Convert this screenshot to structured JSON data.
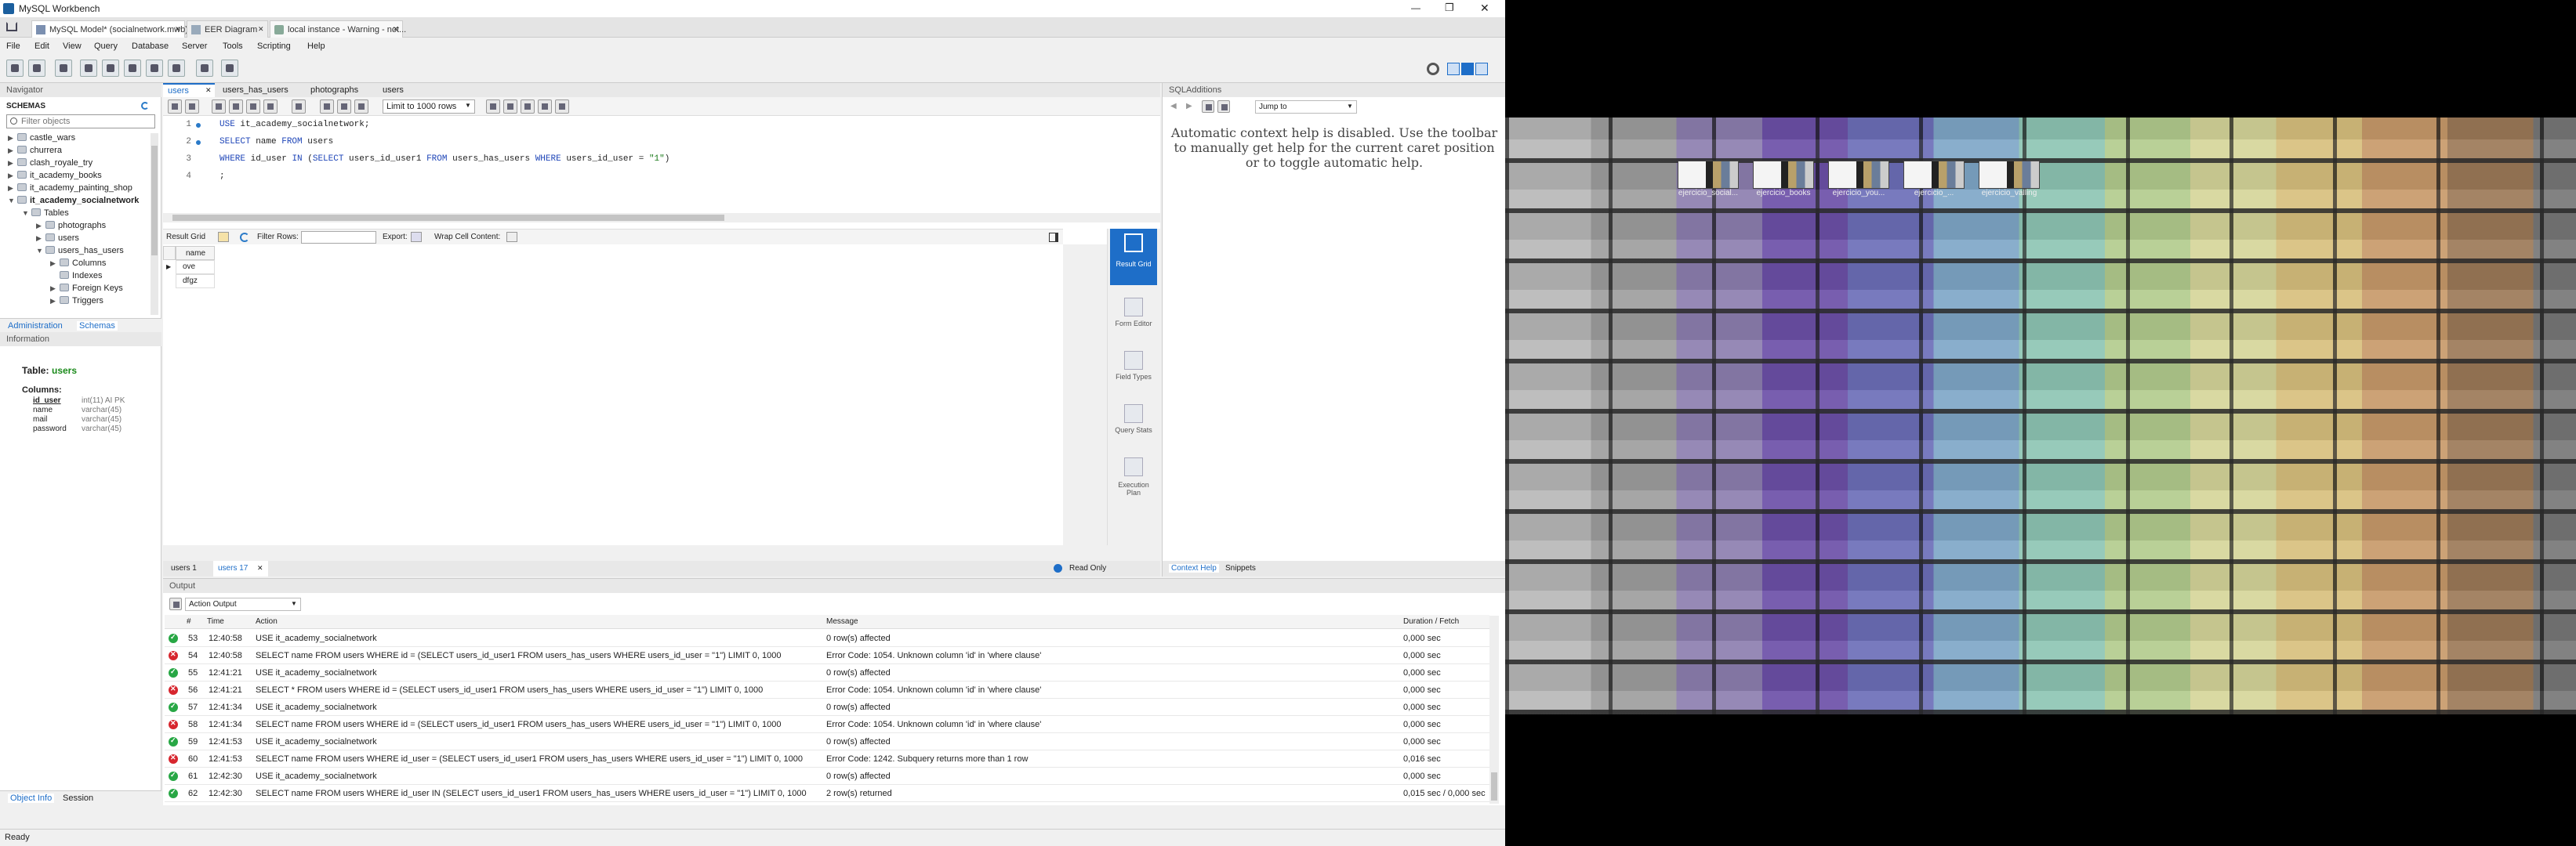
{
  "window": {
    "title": "MySQL Workbench",
    "min": "—",
    "max": "❐",
    "close": "✕"
  },
  "tabs": [
    {
      "label": "MySQL Model* (socialnetwork.mwb)",
      "close": "✕"
    },
    {
      "label": "EER Diagram",
      "close": "✕"
    },
    {
      "label": "local instance - Warning - not...",
      "close": "✕"
    }
  ],
  "menu": [
    "File",
    "Edit",
    "View",
    "Query",
    "Database",
    "Server",
    "Tools",
    "Scripting",
    "Help"
  ],
  "navigator": {
    "title": "Navigator",
    "schemas_label": "SCHEMAS",
    "filter_placeholder": "Filter objects",
    "schemas": [
      "castle_wars",
      "churrera",
      "clash_royale_try",
      "it_academy_books",
      "it_academy_painting_shop",
      "it_academy_socialnetwork"
    ],
    "tables_label": "Tables",
    "tables": [
      "photographs",
      "users",
      "users_has_users"
    ],
    "subitems": [
      "Columns",
      "Indexes",
      "Foreign Keys",
      "Triggers"
    ],
    "tabs": [
      "Administration",
      "Schemas"
    ]
  },
  "information": {
    "title": "Information",
    "table_label": "Table:",
    "table_name": "users",
    "columns_label": "Columns:",
    "columns": [
      {
        "name": "id_user",
        "type": "int(11) AI PK"
      },
      {
        "name": "name",
        "type": "varchar(45)"
      },
      {
        "name": "mail",
        "type": "varchar(45)"
      },
      {
        "name": "password",
        "type": "varchar(45)"
      }
    ],
    "tabs": [
      "Object Info",
      "Session"
    ]
  },
  "editor": {
    "tabs": [
      "users",
      "users_has_users",
      "photographs",
      "users"
    ],
    "limit": "Limit to 1000 rows",
    "lines": [
      "1",
      "2",
      "3",
      "4"
    ],
    "sql1_kw": "USE",
    "sql1_rest": " it_academy_socialnetwork;",
    "sql2_kw1": "SELECT",
    "sql2_name": " name ",
    "sql2_kw2": "FROM",
    "sql2_rest": " users",
    "sql3_kw1": "WHERE",
    "sql3_a": " id_user ",
    "sql3_kw2": "IN",
    "sql3_b": " (",
    "sql3_kw3": "SELECT",
    "sql3_c": " users_id_user1 ",
    "sql3_kw4": "FROM",
    "sql3_d": " users_has_users ",
    "sql3_kw5": "WHERE",
    "sql3_e": " users_id_user = ",
    "sql3_str": "\"1\"",
    "sql3_f": ")",
    "sql4": ";"
  },
  "result": {
    "grid_label": "Result Grid",
    "filter_label": "Filter Rows:",
    "export_label": "Export:",
    "wrap_label": "Wrap Cell Content:",
    "column": "name",
    "rows": [
      "ove",
      "dfgz"
    ],
    "tabs": [
      "users 1",
      "users 17"
    ],
    "readonly": "Read Only"
  },
  "side_panel": [
    {
      "label": "Result Grid"
    },
    {
      "label": "Form Editor"
    },
    {
      "label": "Field Types"
    },
    {
      "label": "Query Stats"
    },
    {
      "label": "Execution Plan"
    }
  ],
  "sql_additions": {
    "title": "SQLAdditions",
    "jump_to": "Jump to",
    "help_text": "Automatic context help is disabled. Use the toolbar to manually get help for the current caret position or to toggle automatic help.",
    "tabs": [
      "Context Help",
      "Snippets"
    ]
  },
  "output": {
    "title": "Output",
    "mode": "Action Output",
    "headers": {
      "num": "#",
      "time": "Time",
      "action": "Action",
      "message": "Message",
      "duration": "Duration / Fetch"
    },
    "rows": [
      {
        "status": "ok",
        "num": "53",
        "time": "12:40:58",
        "action": "USE it_academy_socialnetwork",
        "message": "0 row(s) affected",
        "duration": "0,000 sec"
      },
      {
        "status": "err",
        "num": "54",
        "time": "12:40:58",
        "action": "SELECT name FROM users WHERE id = (SELECT users_id_user1 FROM users_has_users WHERE users_id_user = \"1\") LIMIT 0, 1000",
        "message": "Error Code: 1054. Unknown column 'id' in 'where clause'",
        "duration": "0,000 sec"
      },
      {
        "status": "ok",
        "num": "55",
        "time": "12:41:21",
        "action": "USE it_academy_socialnetwork",
        "message": "0 row(s) affected",
        "duration": "0,000 sec"
      },
      {
        "status": "err",
        "num": "56",
        "time": "12:41:21",
        "action": "SELECT * FROM users WHERE id = (SELECT users_id_user1 FROM users_has_users WHERE users_id_user = \"1\") LIMIT 0, 1000",
        "message": "Error Code: 1054. Unknown column 'id' in 'where clause'",
        "duration": "0,000 sec"
      },
      {
        "status": "ok",
        "num": "57",
        "time": "12:41:34",
        "action": "USE it_academy_socialnetwork",
        "message": "0 row(s) affected",
        "duration": "0,000 sec"
      },
      {
        "status": "err",
        "num": "58",
        "time": "12:41:34",
        "action": "SELECT name FROM users WHERE id = (SELECT users_id_user1 FROM users_has_users WHERE users_id_user = \"1\") LIMIT 0, 1000",
        "message": "Error Code: 1054. Unknown column 'id' in 'where clause'",
        "duration": "0,000 sec"
      },
      {
        "status": "ok",
        "num": "59",
        "time": "12:41:53",
        "action": "USE it_academy_socialnetwork",
        "message": "0 row(s) affected",
        "duration": "0,000 sec"
      },
      {
        "status": "err",
        "num": "60",
        "time": "12:41:53",
        "action": "SELECT name FROM users WHERE id_user = (SELECT users_id_user1 FROM users_has_users WHERE users_id_user = \"1\") LIMIT 0, 1000",
        "message": "Error Code: 1242. Subquery returns more than 1 row",
        "duration": "0,016 sec"
      },
      {
        "status": "ok",
        "num": "61",
        "time": "12:42:30",
        "action": "USE it_academy_socialnetwork",
        "message": "0 row(s) affected",
        "duration": "0,000 sec"
      },
      {
        "status": "ok",
        "num": "62",
        "time": "12:42:30",
        "action": "SELECT name FROM users WHERE id_user IN (SELECT users_id_user1 FROM users_has_users WHERE users_id_user = \"1\") LIMIT 0, 1000",
        "message": "2 row(s) returned",
        "duration": "0,015 sec / 0,000 sec"
      }
    ]
  },
  "status_bar": "Ready",
  "desktop_icons": [
    "ejercicio_social...",
    "ejercicio_books",
    "ejercicio_you...",
    "ejercicio_...",
    "ejercicio_valling"
  ],
  "colors": {
    "accent": "#1e6ec8",
    "ok": "#28a745",
    "err": "#d7262e"
  }
}
